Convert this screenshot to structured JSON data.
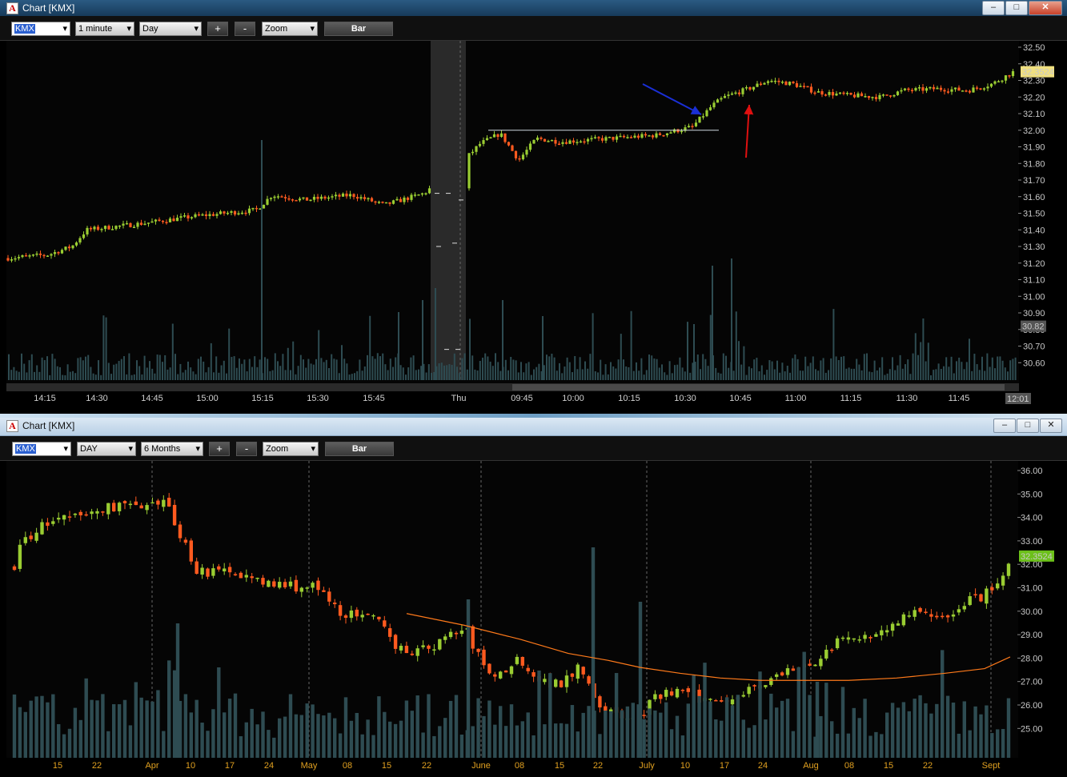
{
  "top_window": {
    "title": "Chart [KMX]",
    "toolbar": {
      "symbol": "KMX",
      "interval": "1 minute",
      "range": "Day",
      "plus": "+",
      "minus": "-",
      "zoom": "Zoom",
      "style": "Bar"
    },
    "price_labels": [
      "32.50",
      "32.40",
      "32.30",
      "32.20",
      "32.10",
      "32.00",
      "31.90",
      "31.80",
      "31.70",
      "31.60",
      "31.50",
      "31.40",
      "31.30",
      "31.20",
      "31.10",
      "31.00",
      "30.90",
      "30.80",
      "30.70",
      "30.60"
    ],
    "last_price": "32.3524",
    "low_marker": "30.82",
    "time_labels": [
      "14:15",
      "14:30",
      "14:45",
      "15:00",
      "15:15",
      "15:30",
      "15:45",
      "Thu",
      "09:45",
      "10:00",
      "10:15",
      "10:30",
      "10:45",
      "11:00",
      "11:15",
      "11:30",
      "11:45"
    ],
    "current_time": "12:01",
    "colors": {
      "up": "#9acd32",
      "down": "#ff5a1f",
      "volume": "#2e4c52",
      "annotation_blue": "#1a2fd6",
      "annotation_red": "#e01010"
    }
  },
  "bottom_window": {
    "title": "Chart [KMX]",
    "toolbar": {
      "symbol": "KMX",
      "interval": "DAY",
      "range": "6 Months",
      "plus": "+",
      "minus": "-",
      "zoom": "Zoom",
      "style": "Bar"
    },
    "price_labels": [
      "36.00",
      "35.00",
      "34.00",
      "33.00",
      "32.00",
      "31.00",
      "30.00",
      "29.00",
      "28.00",
      "27.00",
      "26.00",
      "25.00"
    ],
    "last_price": "32.3524",
    "date_labels": [
      "15",
      "22",
      "Apr",
      "10",
      "17",
      "24",
      "May",
      "08",
      "15",
      "22",
      "June",
      "08",
      "15",
      "22",
      "July",
      "10",
      "17",
      "24",
      "Aug",
      "08",
      "15",
      "22",
      "Sept"
    ],
    "colors": {
      "up": "#9acd32",
      "down": "#ff5a1f",
      "volume": "#2e4c52",
      "moving_average": "#ff7a1a"
    }
  }
}
